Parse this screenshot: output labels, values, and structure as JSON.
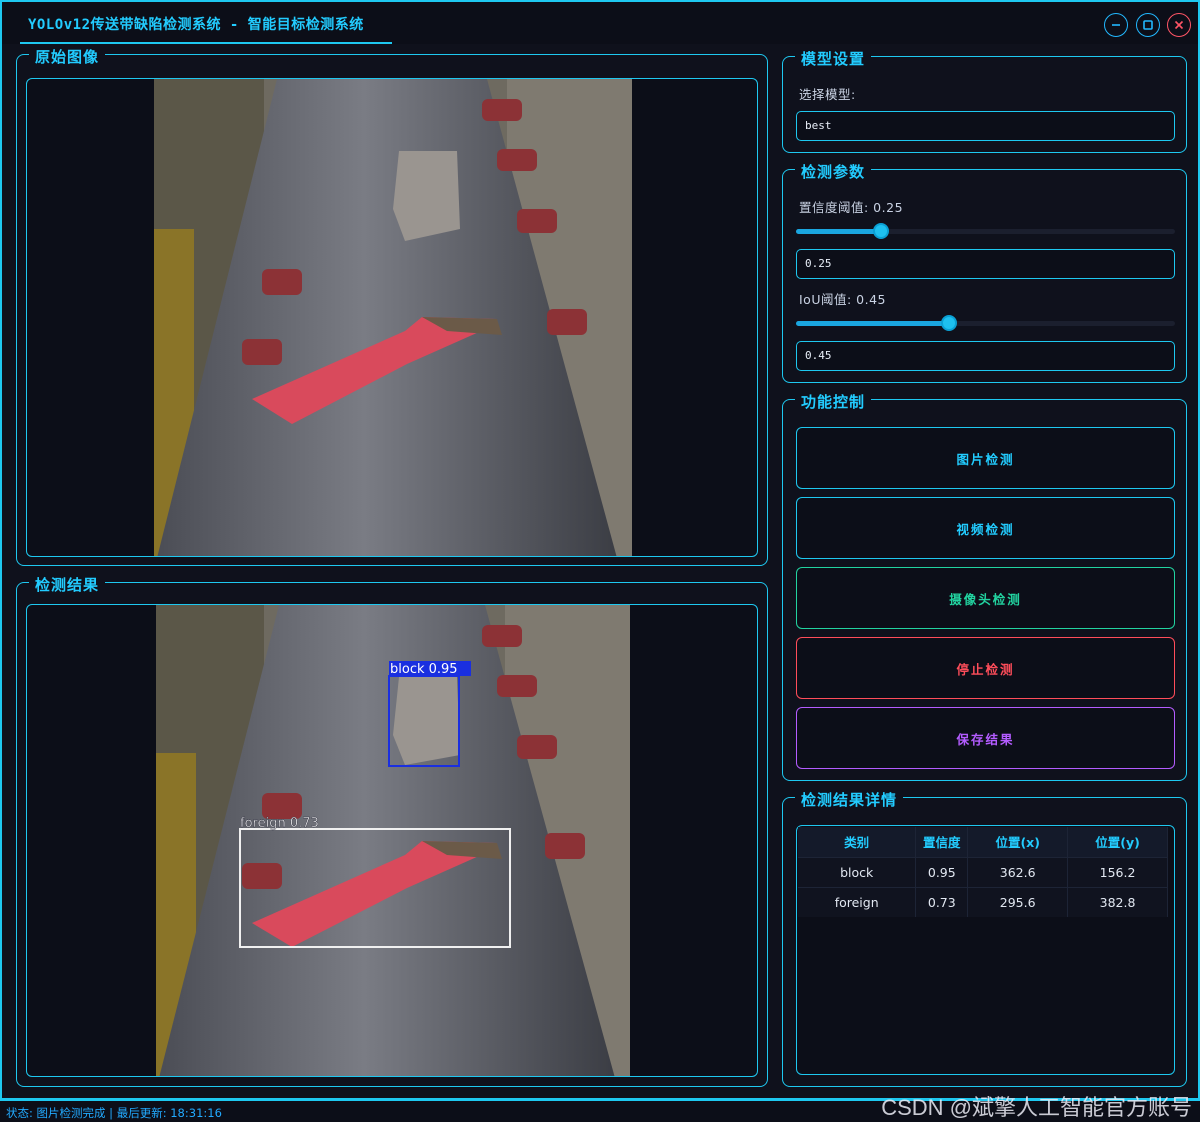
{
  "window": {
    "title": "YOLOv12传送带缺陷检测系统 - 智能目标检测系统",
    "controls": [
      "minimize-icon",
      "maximize-icon",
      "close-icon"
    ]
  },
  "original_panel": {
    "title": "原始图像"
  },
  "result_panel": {
    "title": "检测结果",
    "detections": [
      {
        "label": "block 0.95",
        "color": "#1a2fe0"
      },
      {
        "label": "foreign 0.73",
        "color": "#f0f0f0"
      }
    ]
  },
  "model_settings": {
    "title": "模型设置",
    "select_label": "选择模型:",
    "selected_model": "best"
  },
  "detect_params": {
    "title": "检测参数",
    "conf_label": "置信度阈值: 0.25",
    "conf_value": "0.25",
    "conf_fraction": 0.25,
    "iou_label": "IoU阈值: 0.45",
    "iou_value": "0.45",
    "iou_fraction": 0.45
  },
  "controls": {
    "title": "功能控制",
    "image_detect": "图片检测",
    "video_detect": "视频检测",
    "camera_detect": "摄像头检测",
    "stop_detect": "停止检测",
    "save_result": "保存结果"
  },
  "details": {
    "title": "检测结果详情",
    "headers": [
      "类别",
      "置信度",
      "位置(x)",
      "位置(y)"
    ],
    "rows": [
      [
        "block",
        "0.95",
        "362.6",
        "156.2"
      ],
      [
        "foreign",
        "0.73",
        "295.6",
        "382.8"
      ]
    ]
  },
  "status": {
    "text": "状态: 图片检测完成 | 最后更新: 18:31:16"
  },
  "watermark": "CSDN @斌擎人工智能官方账号",
  "colors": {
    "accent": "#1ec8f0",
    "camera": "#22d3a0",
    "stop": "#ff4d5a",
    "save": "#b45cff"
  }
}
